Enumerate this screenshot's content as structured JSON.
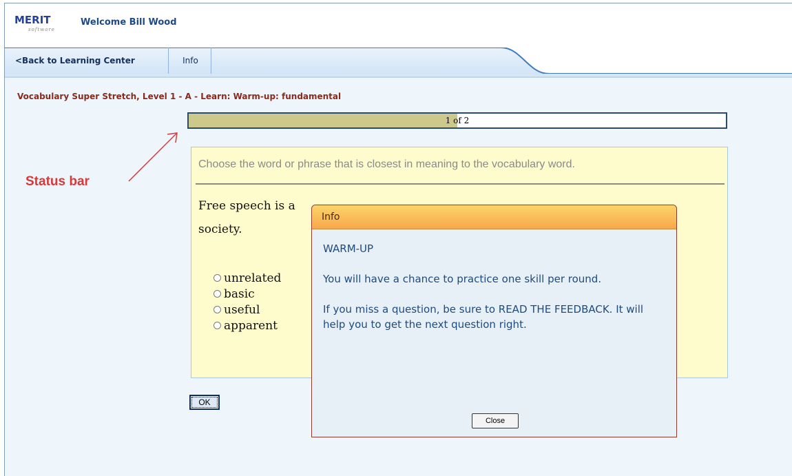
{
  "header": {
    "logo_text": "MERIT",
    "logo_subtext": "software",
    "welcome": "Welcome Bill Wood"
  },
  "nav": {
    "back_label": "<Back to Learning Center",
    "info_label": "Info"
  },
  "lesson": {
    "title": "Vocabulary Super Stretch, Level 1 - A - Learn: Warm-up: fundamental"
  },
  "progress": {
    "text": "1 of 2",
    "current": 1,
    "total": 2
  },
  "annotation": {
    "label": "Status bar",
    "color": "#d8383a"
  },
  "question": {
    "instruction": "Choose the word or phrase that is closest in meaning to the vocabulary word.",
    "sentence_part1": "Free speech is a",
    "sentence_part2": "society.",
    "options": [
      "unrelated",
      "basic",
      "useful",
      "apparent"
    ],
    "submit_label": "OK"
  },
  "dialog": {
    "title": "Info",
    "heading": "WARM-UP",
    "paragraph1": "You will have a chance to practice one skill per round.",
    "paragraph2": "If you miss a question, be sure to READ THE FEEDBACK. It will help you to get the next question right.",
    "close_label": "Close"
  },
  "colors": {
    "accent_blue": "#1e4a86",
    "title_red": "#8a2a1c",
    "dialog_header": "#f7a94a",
    "question_bg": "#fefccd"
  }
}
